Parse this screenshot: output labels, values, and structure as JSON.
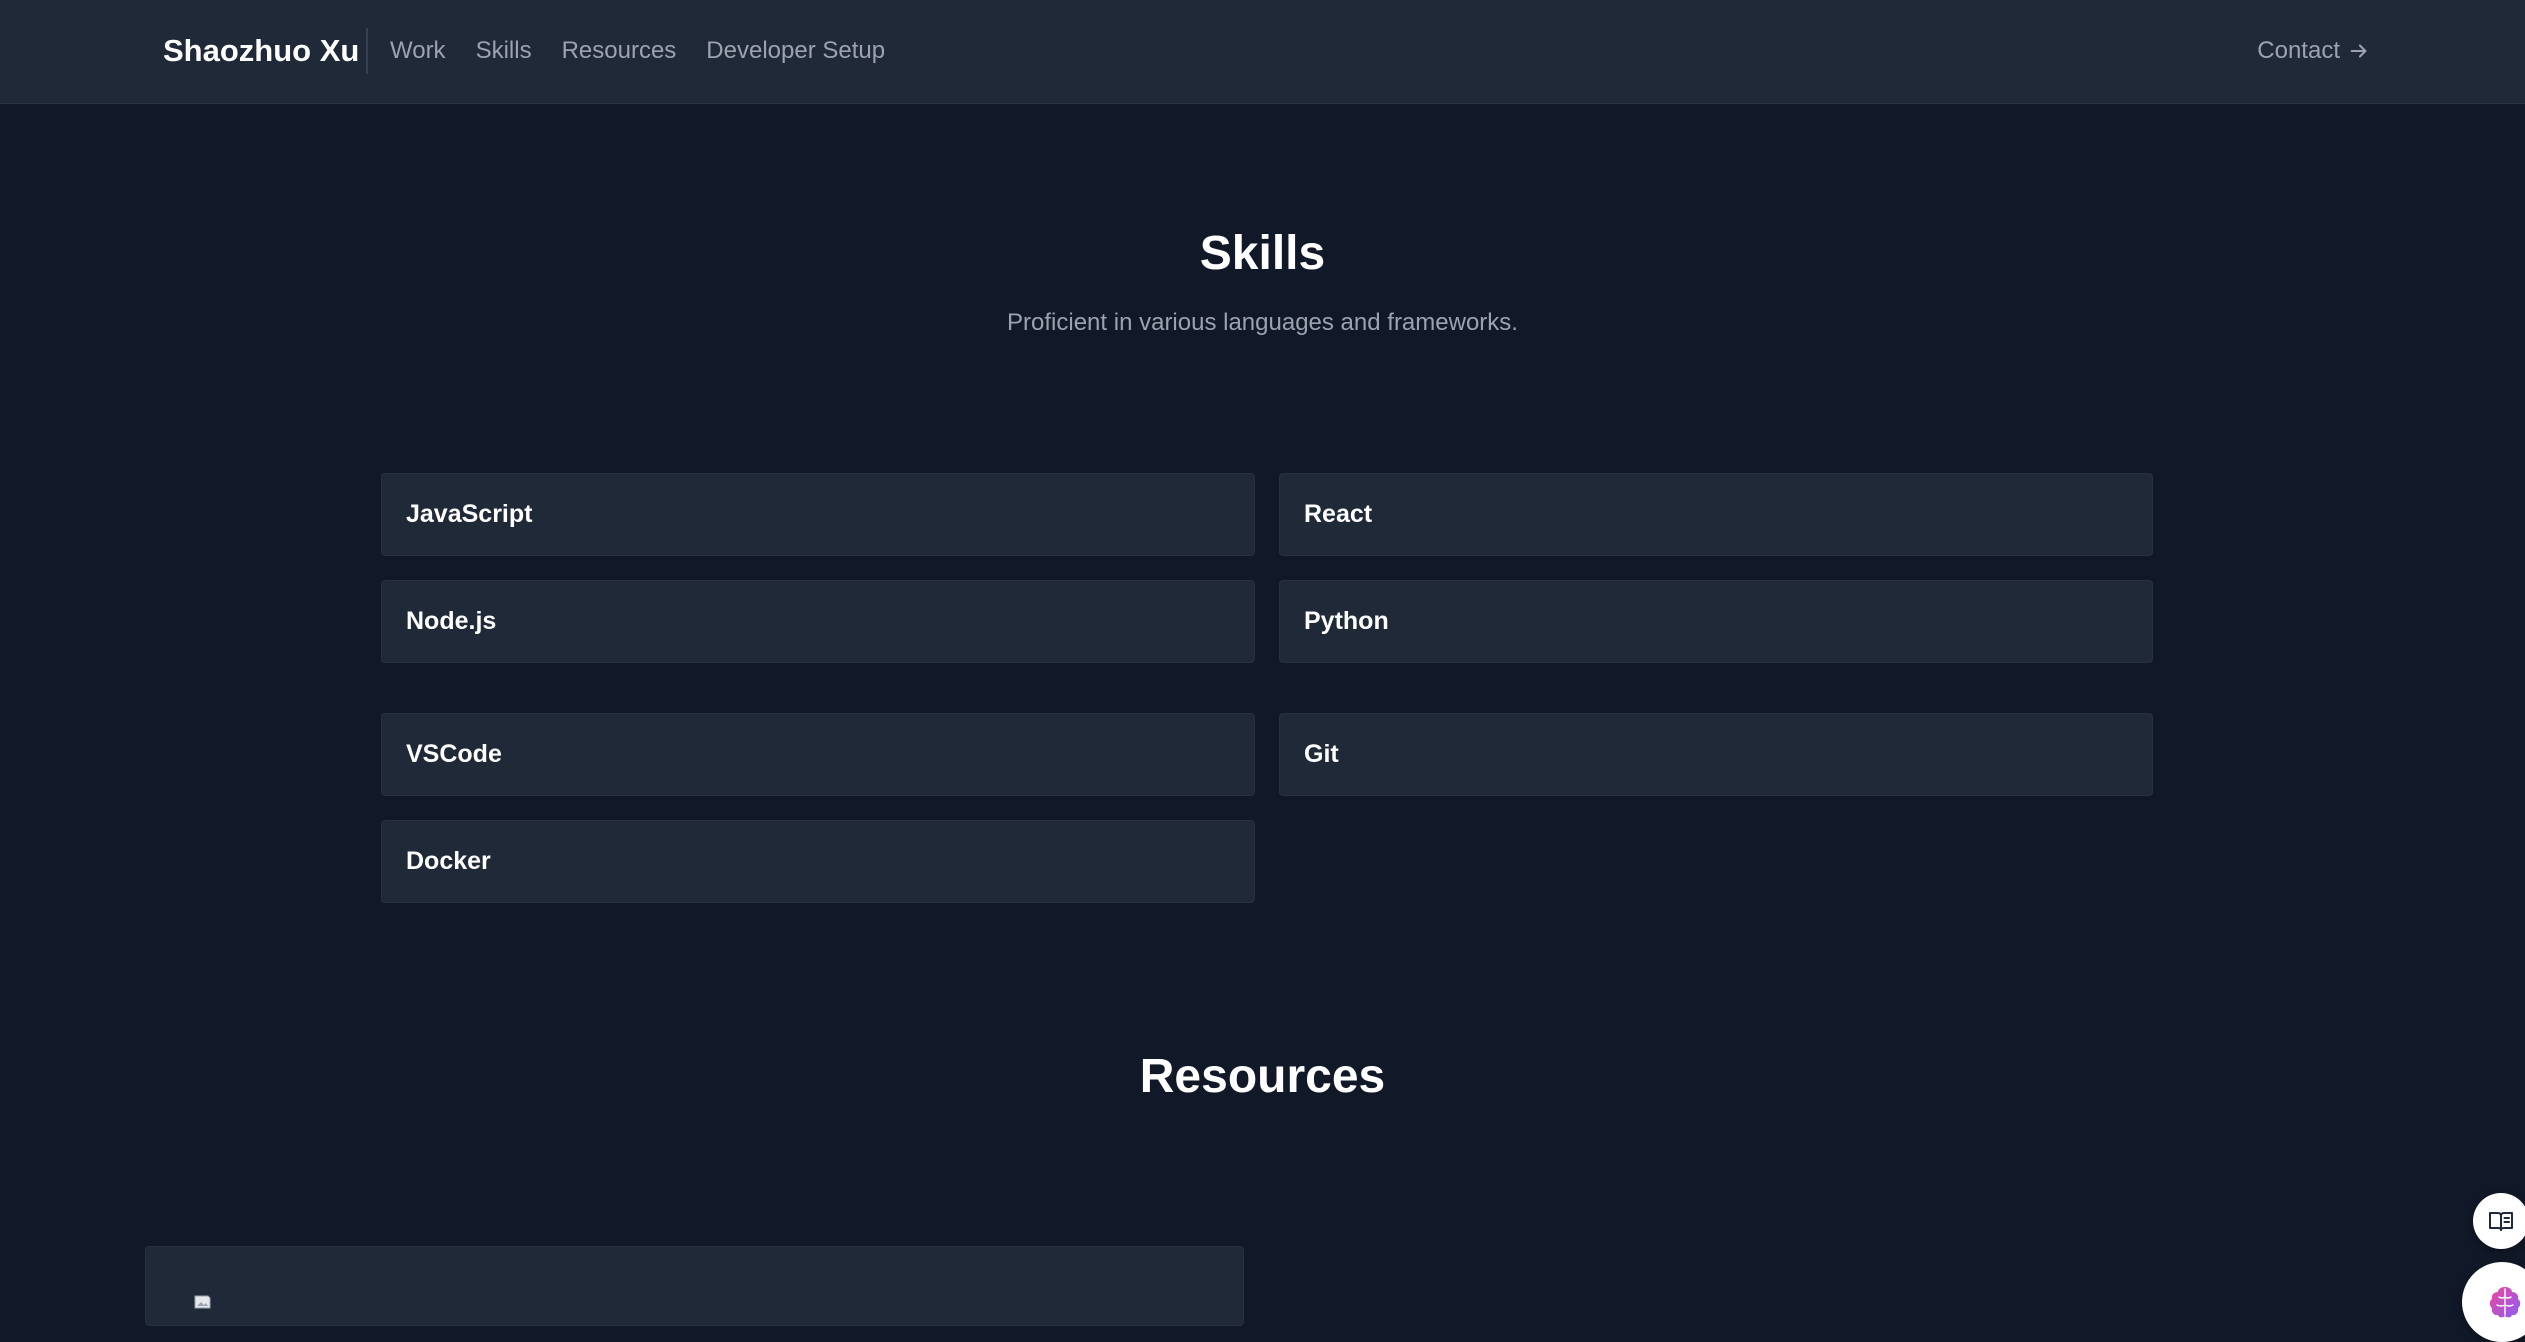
{
  "nav": {
    "brand": "Shaozhuo Xu",
    "links": [
      "Work",
      "Skills",
      "Resources",
      "Developer Setup"
    ],
    "contact": "Contact"
  },
  "skills": {
    "title": "Skills",
    "subtitle": "Proficient in various languages and frameworks.",
    "languages": [
      "JavaScript",
      "React",
      "Node.js",
      "Python"
    ],
    "tools": [
      "VSCode",
      "Git",
      "Docker"
    ]
  },
  "resources": {
    "title": "Resources"
  },
  "widgets": {
    "book": "book-open-icon",
    "brain": "brain-icon"
  },
  "colors": {
    "page_bg": "#111827",
    "nav_bg": "#1f2937",
    "card_bg": "#1f2937",
    "muted_text": "#9ca3af",
    "heading_text": "#ffffff"
  }
}
